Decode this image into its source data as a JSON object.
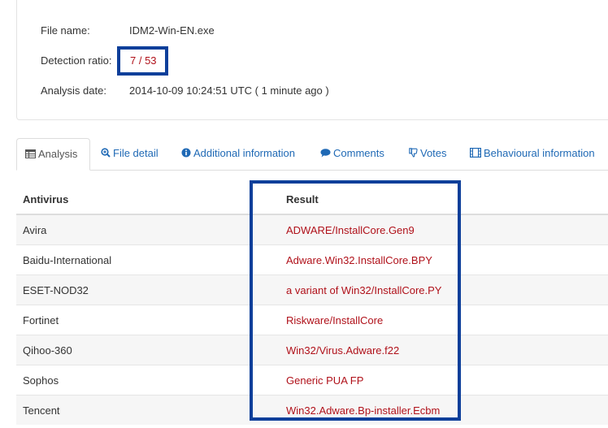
{
  "file_info": {
    "file_name_label": "File name:",
    "file_name": "IDM2-Win-EN.exe",
    "detection_label": "Detection ratio:",
    "detection_ratio": "7 / 53",
    "date_label": "Analysis date:",
    "analysis_date": "2014-10-09 10:24:51 UTC ( 1 minute ago )"
  },
  "tabs": [
    {
      "label": "Analysis",
      "icon": "table-icon",
      "active": true
    },
    {
      "label": "File detail",
      "icon": "magnifier-plus-icon",
      "active": false
    },
    {
      "label": "Additional information",
      "icon": "info-circle-icon",
      "active": false
    },
    {
      "label": "Comments",
      "icon": "speech-bubble-icon",
      "active": false
    },
    {
      "label": "Votes",
      "icon": "thumbs-down-icon",
      "active": false
    },
    {
      "label": "Behavioural information",
      "icon": "film-icon",
      "active": false
    }
  ],
  "table": {
    "headers": [
      "Antivirus",
      "Result"
    ],
    "rows": [
      {
        "antivirus": "Avira",
        "result": "ADWARE/InstallCore.Gen9"
      },
      {
        "antivirus": "Baidu-International",
        "result": "Adware.Win32.InstallCore.BPY"
      },
      {
        "antivirus": "ESET-NOD32",
        "result": "a variant of Win32/InstallCore.PY"
      },
      {
        "antivirus": "Fortinet",
        "result": "Riskware/InstallCore"
      },
      {
        "antivirus": "Qihoo-360",
        "result": "Win32/Virus.Adware.f22"
      },
      {
        "antivirus": "Sophos",
        "result": "Generic PUA FP"
      },
      {
        "antivirus": "Tencent",
        "result": "Win32.Adware.Bp-installer.Ecbm"
      }
    ]
  },
  "colors": {
    "link": "#1f69b5",
    "detection": "#b0111a",
    "highlight_box": "#0d3f9a"
  }
}
